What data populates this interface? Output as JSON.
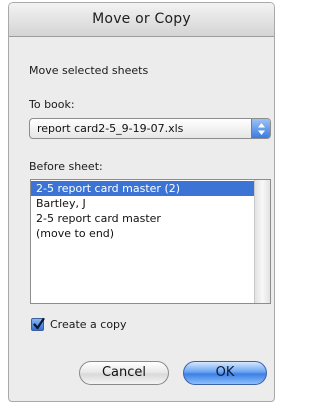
{
  "dialog": {
    "title": "Move or Copy",
    "instruction": "Move selected sheets",
    "to_book_label": "To book:",
    "to_book_value": "report card2-5_9-19-07.xls",
    "before_sheet_label": "Before sheet:",
    "sheets": [
      {
        "label": "2-5 report card master (2)",
        "selected": true
      },
      {
        "label": "Bartley, J",
        "selected": false
      },
      {
        "label": "2-5 report card master",
        "selected": false
      },
      {
        "label": "(move to end)",
        "selected": false
      }
    ],
    "create_copy_label": "Create a copy",
    "create_copy_checked": true,
    "cancel_label": "Cancel",
    "ok_label": "OK"
  },
  "colors": {
    "selection": "#3c74d6",
    "accent": "#3d7fe4"
  }
}
